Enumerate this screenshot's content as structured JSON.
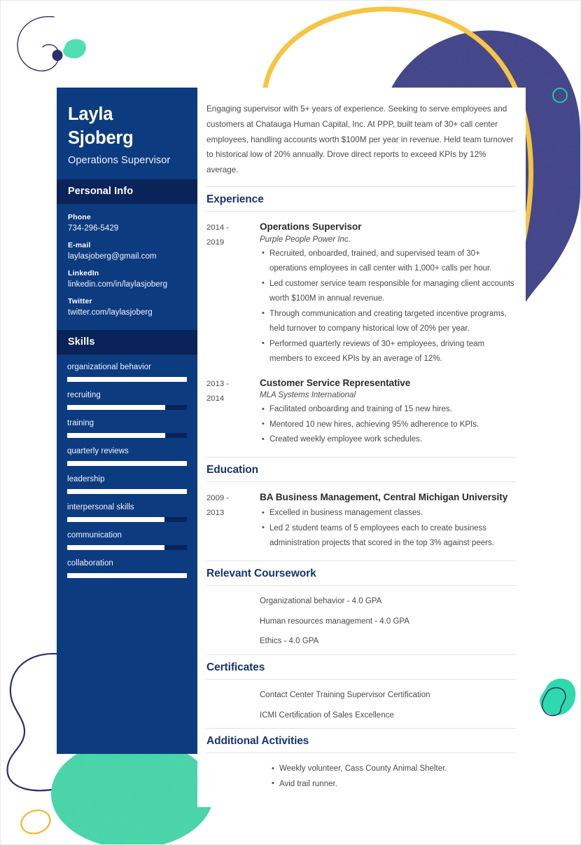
{
  "colors": {
    "sidebar": "#0d3b80",
    "sidebar_heading_band": "#0a2358",
    "heading_navy": "#17356d",
    "body_text": "#4a4a4a",
    "accent_teal": "#3fdcb0",
    "accent_yellow": "#f5c543",
    "accent_dark_navy": "#2b2f6b",
    "blob_purple": "#4a4d94"
  },
  "sidebar": {
    "name_line1": "Layla",
    "name_line2": "Sjoberg",
    "job_title": "Operations Supervisor",
    "personal_info_heading": "Personal Info",
    "contacts": [
      {
        "label": "Phone",
        "value": "734-296-5429"
      },
      {
        "label": "E-mail",
        "value": "laylasjoberg@gmail.com"
      },
      {
        "label": "LinkedIn",
        "value": "linkedin.com/in/laylasjoberg"
      },
      {
        "label": "Twitter",
        "value": "twitter.com/laylasjoberg"
      }
    ],
    "skills_heading": "Skills",
    "skills": [
      {
        "name": "organizational behavior",
        "level": 100
      },
      {
        "name": "recruiting",
        "level": 82
      },
      {
        "name": "training",
        "level": 82
      },
      {
        "name": "quarterly reviews",
        "level": 100
      },
      {
        "name": "leadership",
        "level": 100
      },
      {
        "name": "interpersonal skills",
        "level": 81
      },
      {
        "name": "communication",
        "level": 81
      },
      {
        "name": "collaboration",
        "level": 100
      }
    ]
  },
  "main": {
    "summary": "Engaging supervisor with 5+ years of experience. Seeking to serve employees and customers at Chatauga Human Capital, Inc. At PPP, built team of 30+ call center employees, handling accounts worth $100M per year in revenue. Held team turnover to historical low of 20% annually. Drove direct reports to exceed KPIs by 12% average.",
    "experience": {
      "heading": "Experience",
      "entries": [
        {
          "dates_line1": "2014 -",
          "dates_line2": "2019",
          "role": "Operations Supervisor",
          "org": "Purple People Power Inc.",
          "bullets": [
            "Recruited, onboarded, trained, and supervised team of 30+ operations employees in call center with 1,000+ calls per hour.",
            "Led customer service team responsible for managing client accounts worth $100M in annual revenue.",
            "Through communication and creating targeted incentive programs, held turnover to company historical low of 20% per year.",
            "Performed quarterly reviews of 30+ employees, driving team members to exceed KPIs by an average of 12%."
          ]
        },
        {
          "dates_line1": "2013 -",
          "dates_line2": "2014",
          "role": "Customer Service Representative",
          "org": "MLA Systems International",
          "bullets": [
            "Facilitated onboarding and training of 15 new hires.",
            "Mentored 10 new hires, achieving 95% adherence to KPIs.",
            "Created weekly employee work schedules."
          ]
        }
      ]
    },
    "education": {
      "heading": "Education",
      "entries": [
        {
          "dates_line1": "2009 -",
          "dates_line2": "2013",
          "degree": "BA Business Management, Central Michigan University",
          "bullets": [
            "Excelled in business management classes.",
            "Led 2 student teams of 5 employees each to create business administration projects that scored in the top 3% against peers."
          ]
        }
      ]
    },
    "coursework": {
      "heading": "Relevant Coursework",
      "items": [
        "Organizational behavior - 4.0 GPA",
        "Human resources management - 4.0 GPA",
        "Ethics - 4.0 GPA"
      ]
    },
    "certificates": {
      "heading": "Certificates",
      "items": [
        "Contact Center Training Supervisor Certification",
        "ICMI Certification of Sales Excellence"
      ]
    },
    "activities": {
      "heading": "Additional Activities",
      "items": [
        "Weekly volunteer, Cass County Animal Shelter.",
        "Avid trail runner."
      ]
    }
  }
}
